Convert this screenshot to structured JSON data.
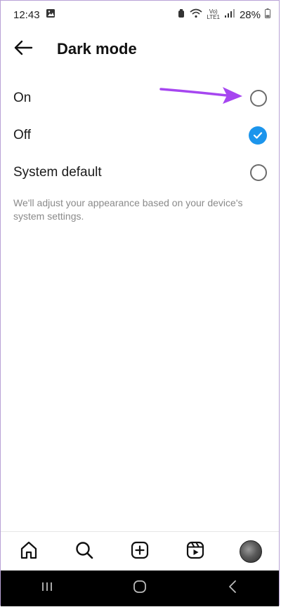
{
  "status_bar": {
    "time": "12:43",
    "battery_percent": "28%",
    "net_label_top": "Vo)",
    "net_label_bottom": "LTE1"
  },
  "header": {
    "title": "Dark mode"
  },
  "options": [
    {
      "label": "On",
      "selected": false
    },
    {
      "label": "Off",
      "selected": true
    },
    {
      "label": "System default",
      "selected": false
    }
  ],
  "helper_text": "We'll adjust your appearance based on your device's system settings.",
  "colors": {
    "accent": "#1c95ec",
    "arrow": "#a646f0"
  },
  "icons": {
    "back": "arrow-left-icon",
    "home": "home-icon",
    "search": "search-icon",
    "create": "plus-square-icon",
    "reels": "reels-icon",
    "profile": "avatar"
  }
}
